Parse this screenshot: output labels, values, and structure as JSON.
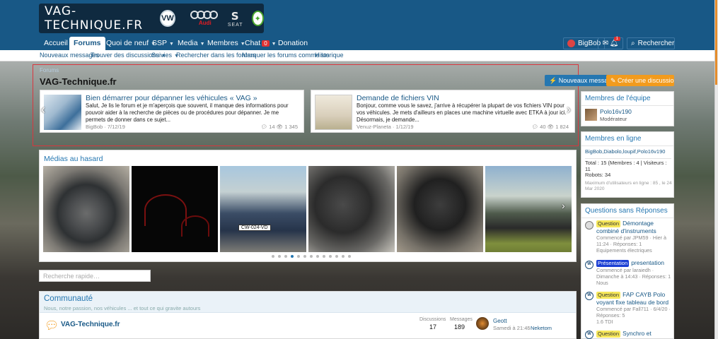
{
  "site": {
    "logo_text": "VAG-TECHNIQUE.FR",
    "brands": [
      "vw-logo",
      "audi-logo",
      "seat-logo",
      "skoda-logo"
    ],
    "audi_word": "Audi",
    "seat_word": "SEAT"
  },
  "nav": {
    "items": [
      "Accueil",
      "Forums",
      "Quoi de neuf",
      "SSP",
      "Media",
      "Membres",
      "Chat",
      "Donation"
    ],
    "chat_badge": "0",
    "user": "BigBob",
    "alert_badge": "1",
    "search": "Rechercher"
  },
  "subnav": [
    "Nouveaux messages",
    "Trouver des discussions",
    "Suivies",
    "Rechercher dans les forums",
    "Marquer les forums comme lus",
    "Historique"
  ],
  "hero": {
    "breadcrumb": "Forums",
    "title": "VAG-Technique.fr",
    "btn_new_messages": "Nouveaux messages",
    "btn_new_discussion": "Créer une discussion…"
  },
  "featured": [
    {
      "title": "Bien démarrer pour dépanner les véhicules « VAG »",
      "excerpt": "Salut, Je lis le forum et je m'aperçois que souvent, il manque des informations pour pouvoir aider à la recherche de pièces ou de procédures pour dépanner. Je me permets de donner dans ce sujet...",
      "author": "BigBob",
      "date": "7/12/19",
      "replies": "14",
      "views": "1 345"
    },
    {
      "title": "Demande de fichiers VIN",
      "excerpt": "Bonjour, comme vous le savez, j'arrive à récupérer la plupart de vos fichiers VIN pour vos véhicules. Je mets d'ailleurs en places une machine virtuelle avec ETKA à jour ici. Désormais, je demande...",
      "author": "Venuz-Planeta",
      "date": "1/12/19",
      "replies": "40",
      "views": "1 824"
    }
  ],
  "medias": {
    "title": "Médias au hasard",
    "plate_text": "CW-024-VD",
    "dot_count": 13,
    "active_dot": 3
  },
  "quick_search": {
    "placeholder": "Recherche rapide…"
  },
  "community": {
    "title": "Communauté",
    "desc": "Nous, notre passion, nos véhicules ... et tout ce qui gravite autours",
    "forum": "VAG-Technique.fr",
    "discussions_label": "Discussions",
    "messages_label": "Messages",
    "discussions": "17",
    "messages": "189",
    "last_title": "Geott",
    "last_date": "Samedi à 21:45",
    "last_user": "Neketom"
  },
  "staff": {
    "title": "Membres de l'équipe",
    "name": "Polo16v190",
    "role": "Modérateur"
  },
  "online": {
    "title": "Membres en ligne",
    "list": "BigBob,Diabolo,loupif,Polo16v190",
    "stats": "Total : 15 (Membres : 4 | Visiteurs : 11",
    "robots": "Robots: 34",
    "max": "Maximum d'utilisateurs en ligne : 85 , le 24 Mar 2020"
  },
  "unanswered": {
    "title": "Questions sans Réponses",
    "items": [
      {
        "label": "Question",
        "title": "Démontage combiné d'instruments",
        "meta": "Commencé par JPM59 · Hier à 11:24 · Réponses: 1",
        "cat": "Equipements électriques"
      },
      {
        "label": "Présentation",
        "title": "presentation",
        "meta": "Commencé par laraiedh · Dimanche à 14:43 · Réponses: 1",
        "cat": "Nous"
      },
      {
        "label": "Question",
        "title": "FAP CAYB Polo voyant fixe tableau de bord",
        "meta": "Commencé par Fall711 · 6/4/20 · Réponses: 5",
        "cat": "1.6 TDI"
      },
      {
        "label": "Question",
        "title": "Synchro et injection",
        "meta": "",
        "cat": ""
      }
    ]
  },
  "colors": {
    "header": "#185886",
    "link": "#2577b1",
    "orange": "#f29b1d",
    "hero_border": "#d9363e"
  }
}
